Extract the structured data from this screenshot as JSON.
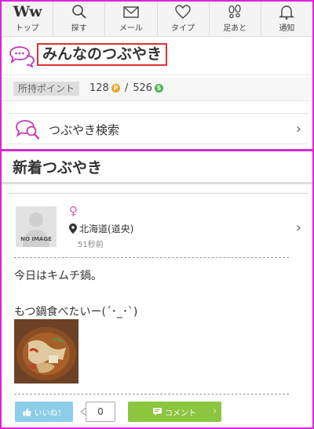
{
  "nav": {
    "items": [
      {
        "label": "トップ",
        "icon": "ww-logo-icon",
        "logo_text": "Ww"
      },
      {
        "label": "探す",
        "icon": "search-icon"
      },
      {
        "label": "メール",
        "icon": "mail-icon"
      },
      {
        "label": "タイプ",
        "icon": "heart-icon"
      },
      {
        "label": "足あと",
        "icon": "footprint-icon"
      },
      {
        "label": "通知",
        "icon": "bell-icon"
      }
    ]
  },
  "page": {
    "title": "みんなのつぶやき",
    "title_icon": "chat-bubbles-icon"
  },
  "points": {
    "label": "所持ポイント",
    "p_value": "128",
    "p_badge": "P",
    "sep": "/",
    "s_value": "526",
    "s_badge": "S"
  },
  "search_card": {
    "label": "つぶやき検索",
    "icon": "chat-search-icon"
  },
  "section": {
    "title": "新着つぶやき"
  },
  "post": {
    "avatar_text": "NO IMAGE",
    "gender_symbol": "♀",
    "location": "北海道(道央)",
    "time": "51秒前",
    "line1": "今日はキムチ鍋。",
    "line2": "もつ鍋食べたいー(´･_･`)",
    "like_label": "いいね！",
    "like_count": "0",
    "comment_label": "コメント"
  },
  "colors": {
    "accent_pink": "#cf2ecf",
    "title_box": "#dd3333",
    "like_blue": "#8ccde8",
    "comment_green": "#8cc63f",
    "gender_pink": "#d060b0"
  }
}
